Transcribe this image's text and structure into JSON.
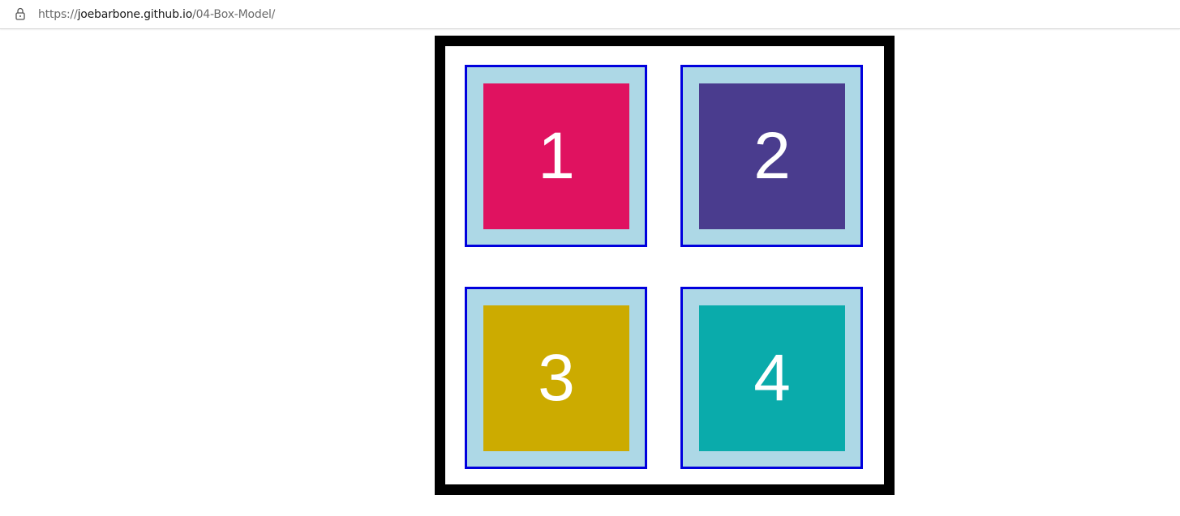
{
  "address_bar": {
    "url_scheme": "https://",
    "url_host": "joebarbone.github.io",
    "url_path": "/04-Box-Model/",
    "icon": "lock-icon"
  },
  "colors": {
    "container_border": "#000000",
    "outer_box_fill": "#add8e6",
    "outer_box_border": "#0000dd",
    "box_1": "#e01260",
    "box_2": "#4a3c8e",
    "box_3": "#ccab00",
    "box_4": "#0aabab"
  },
  "boxes": [
    {
      "label": "1"
    },
    {
      "label": "2"
    },
    {
      "label": "3"
    },
    {
      "label": "4"
    }
  ]
}
